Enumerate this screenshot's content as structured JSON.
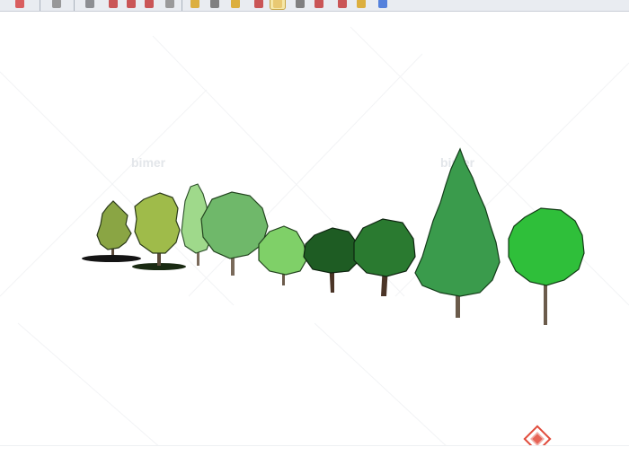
{
  "toolbar": {
    "buttons": [
      {
        "name": "select-icon",
        "color": "#d64545"
      },
      {
        "name": "eraser-icon",
        "color": "#8a8a8a"
      },
      {
        "name": "rectangle-icon",
        "color": "#7c7f83"
      },
      {
        "name": "push-pull-icon",
        "color": "#c43c3c"
      },
      {
        "name": "rotate-icon",
        "color": "#c43c3c"
      },
      {
        "name": "follow-me-icon",
        "color": "#c43c3c"
      },
      {
        "name": "offset-icon",
        "color": "#8c8c8c"
      },
      {
        "name": "tape-measure-icon",
        "color": "#d9a520"
      },
      {
        "name": "dimension-icon",
        "color": "#6d6d6d"
      },
      {
        "name": "paint-bucket-icon",
        "color": "#d9a520"
      },
      {
        "name": "orbit-icon",
        "color": "#c43c3c"
      },
      {
        "name": "pan-icon",
        "color": "#e6c36a"
      },
      {
        "name": "zoom-icon",
        "color": "#6d6d6d"
      },
      {
        "name": "zoom-extents-icon",
        "color": "#c43c3c"
      },
      {
        "name": "walk-icon",
        "color": "#c43c3c"
      },
      {
        "name": "look-around-icon",
        "color": "#d9a520"
      },
      {
        "name": "position-camera-icon",
        "color": "#3a6fd8"
      }
    ]
  },
  "canvas": {
    "background": "#ffffff",
    "watermark_text": "bimer",
    "trees": [
      {
        "name": "tree-small-olive",
        "type": "deciduous",
        "color": "#8aa544"
      },
      {
        "name": "tree-olive-round",
        "type": "deciduous",
        "color": "#9fbb4a"
      },
      {
        "name": "tree-light-narrow",
        "type": "deciduous",
        "color": "#9fd98b"
      },
      {
        "name": "tree-medium-green",
        "type": "deciduous",
        "color": "#6fb86a"
      },
      {
        "name": "tree-bright-round",
        "type": "deciduous",
        "color": "#7fd068"
      },
      {
        "name": "tree-dark-spreading",
        "type": "deciduous",
        "color": "#1e5c23"
      },
      {
        "name": "tree-dark-broad",
        "type": "deciduous",
        "color": "#2a7a30"
      },
      {
        "name": "tree-conifer",
        "type": "conifer",
        "color": "#3a9b4c"
      },
      {
        "name": "tree-large-leafy",
        "type": "deciduous",
        "color": "#2fbf3a"
      }
    ]
  },
  "logo": {
    "name": "site-logo",
    "color": "#e14b3b"
  }
}
